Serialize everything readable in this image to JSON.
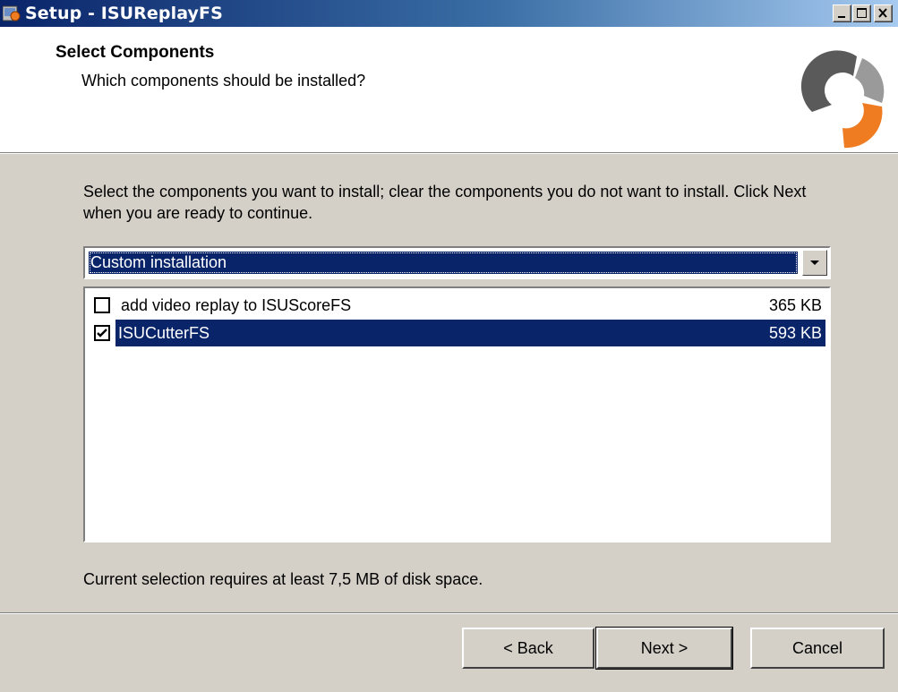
{
  "window": {
    "title": "Setup - ISUReplayFS",
    "controls": [
      "minimize",
      "maximize",
      "close"
    ]
  },
  "header": {
    "title": "Select Components",
    "subtitle": "Which components should be installed?"
  },
  "body": {
    "intro": "Select the components you want to install; clear the components you do not want to install. Click Next when you are ready to continue.",
    "installation_type": {
      "selected": "Custom installation"
    },
    "components": [
      {
        "label": "add video replay to ISUScoreFS",
        "size": "365 KB",
        "checked": false,
        "selected": false
      },
      {
        "label": "ISUCutterFS",
        "size": "593 KB",
        "checked": true,
        "selected": true
      }
    ],
    "space_required": "Current selection requires at least 7,5 MB of disk space."
  },
  "buttons": {
    "back": "< Back",
    "next": "Next >",
    "cancel": "Cancel"
  },
  "colors": {
    "title_bar_start": "#0a246a",
    "title_bar_end": "#a6caf0",
    "selection": "#0a246a",
    "dialog_bg": "#d4d0c8",
    "logo_orange": "#f07c22",
    "logo_gray": "#5a5a5a"
  }
}
